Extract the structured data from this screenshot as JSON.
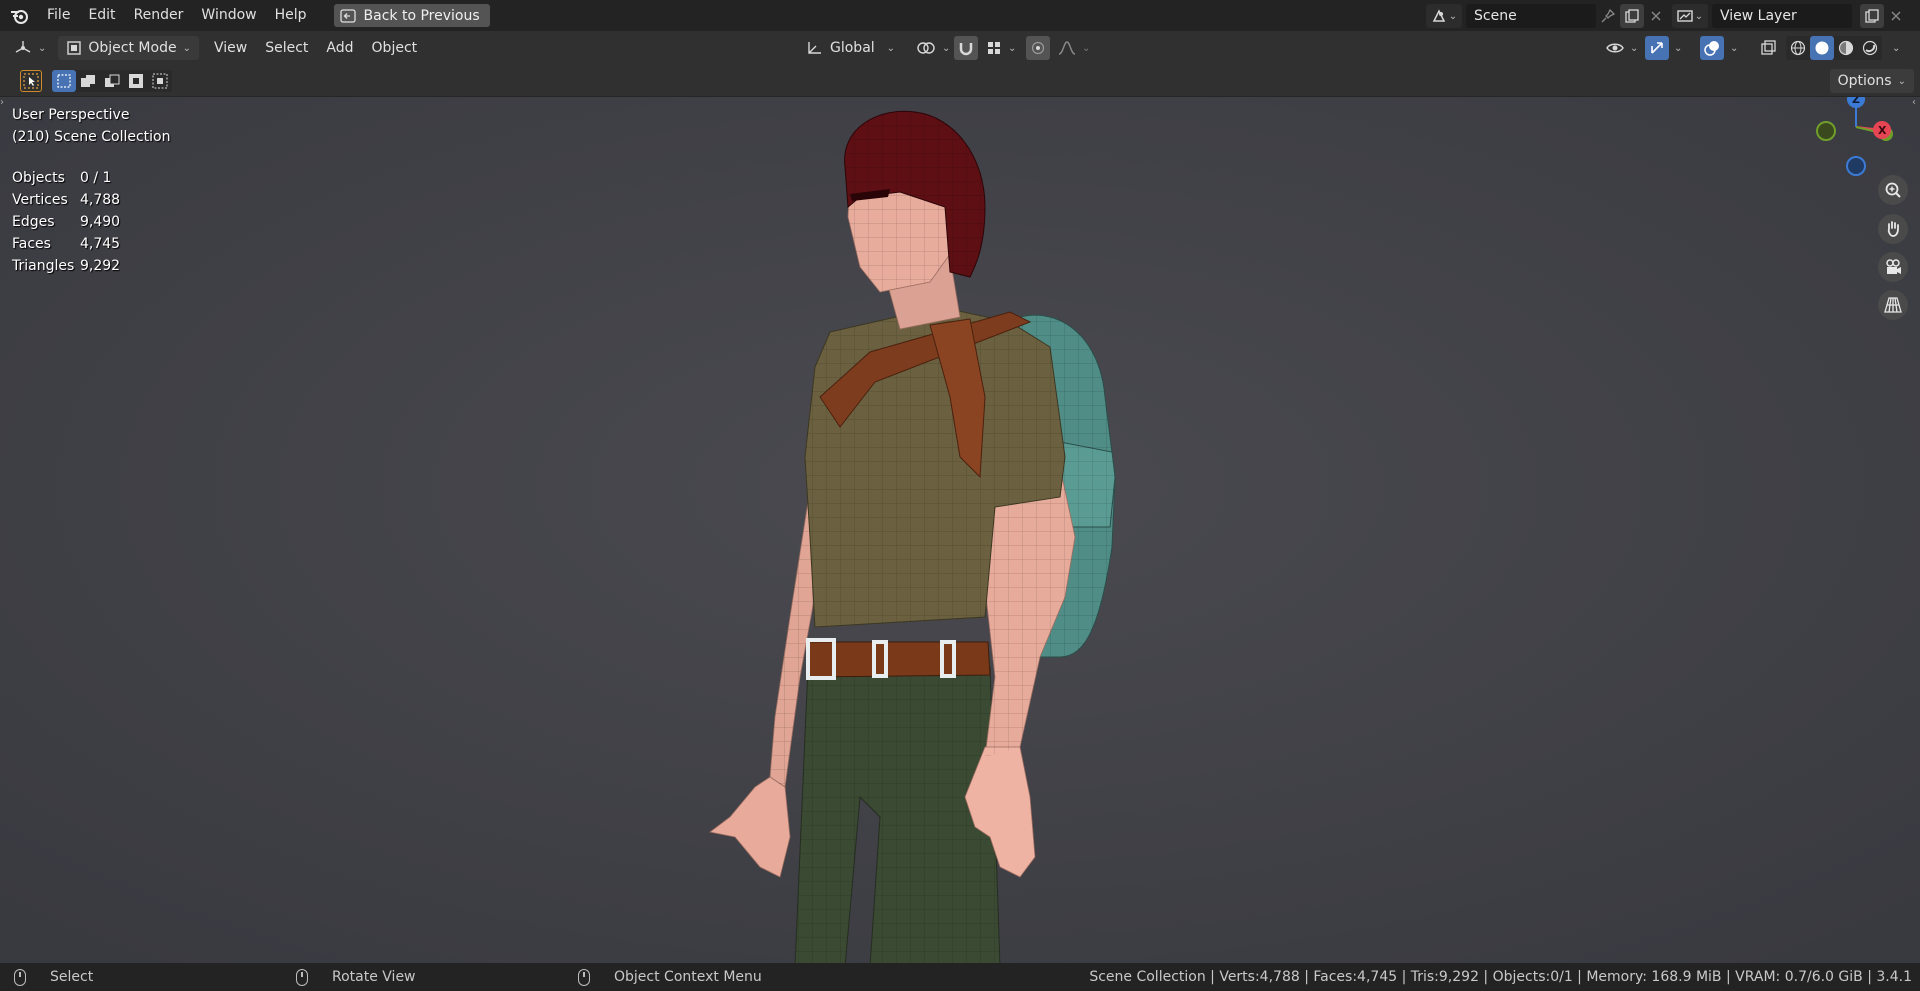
{
  "topbar": {
    "menus": [
      "File",
      "Edit",
      "Render",
      "Window",
      "Help"
    ],
    "back_label": "Back to Previous",
    "scene_name": "Scene",
    "view_layer": "View Layer"
  },
  "header": {
    "mode": "Object Mode",
    "menus": [
      "View",
      "Select",
      "Add",
      "Object"
    ],
    "transform_orientation": "Global"
  },
  "toolrow": {
    "options_label": "Options"
  },
  "viewport": {
    "perspective": "User Perspective",
    "collection": "(210) Scene Collection",
    "stats": [
      {
        "label": "Objects",
        "value": "0 / 1"
      },
      {
        "label": "Vertices",
        "value": "4,788"
      },
      {
        "label": "Edges",
        "value": "9,490"
      },
      {
        "label": "Faces",
        "value": "4,745"
      },
      {
        "label": "Triangles",
        "value": "9,292"
      }
    ],
    "gizmo": {
      "z": "Z",
      "x": "X"
    }
  },
  "statusbar": {
    "left_action": "Select",
    "middle_action": "Rotate View",
    "right_action": "Object Context Menu",
    "info": "Scene Collection | Verts:4,788 | Faces:4,745 | Tris:9,292 | Objects:0/1 | Memory: 168.9 MiB | VRAM: 0.7/6.0 GiB | 3.4.1"
  },
  "colors": {
    "viewport_bg": "#3d3d3d",
    "accent_blue": "#4772b3",
    "axis_x": "#e64553",
    "axis_y": "#6f9e2b",
    "axis_z": "#3b7bd6"
  }
}
